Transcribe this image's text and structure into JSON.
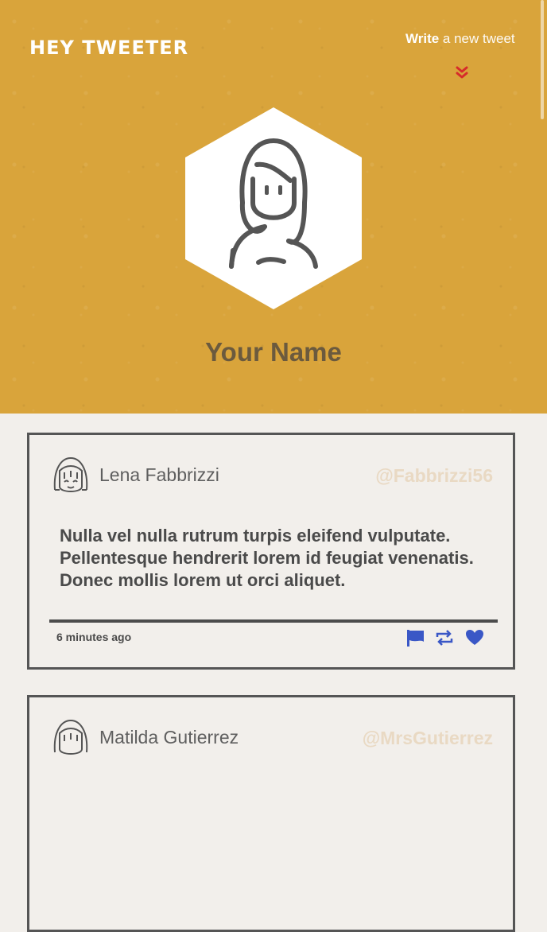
{
  "header": {
    "brand": "HEY TWEETER",
    "write_strong": "Write",
    "write_rest": " a new tweet",
    "chevron_icon": "double-chevron-down-icon"
  },
  "profile": {
    "name": "Your Name",
    "avatar_icon": "girl-avatar-icon"
  },
  "colors": {
    "hero_bg": "#d9a43b",
    "page_bg": "#f2efeb",
    "accent_blue": "#3a57c6",
    "handle": "#e9d9c3"
  },
  "tweets": [
    {
      "name": "Lena Fabbrizzi",
      "handle": "@Fabbrizzi56",
      "body": "Nulla vel nulla rutrum turpis eleifend vulputate. Pellentesque hendrerit lorem id feugiat venenatis. Donec mollis lorem ut orci aliquet.",
      "time": "6 minutes ago",
      "actions": [
        "flag-icon",
        "retweet-icon",
        "heart-icon"
      ]
    },
    {
      "name": "Matilda Gutierrez",
      "handle": "@MrsGutierrez"
    }
  ]
}
